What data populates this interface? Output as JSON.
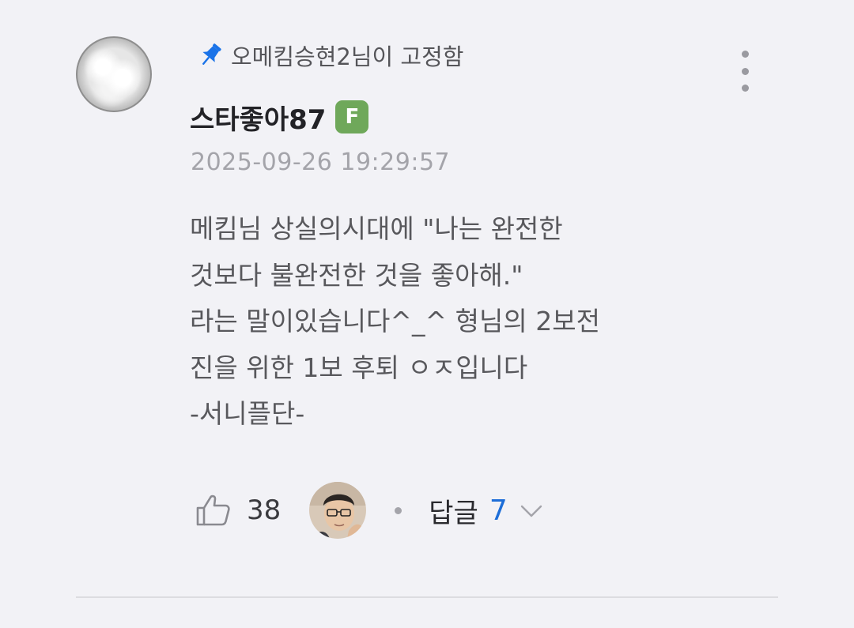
{
  "comment": {
    "pinned_text": "오메킴승현2님이 고정함",
    "author": {
      "name": "스타좋아87",
      "badge": "F"
    },
    "timestamp": "2025-09-26 19:29:57",
    "body_lines": [
      "메킴님 상실의시대에 \"나는 완전한",
      "것보다 불완전한 것을 좋아해.\"",
      "라는 말이있습니다^_^ 형님의 2보전",
      "진을 위한 1보 후퇴 ㅇㅈ입니다",
      "-서니플단-"
    ],
    "likes": "38",
    "reply_label": "답글",
    "reply_count": "7",
    "icons": {
      "pin": "pin-icon",
      "more": "more-vertical-icon",
      "like": "thumbs-up-icon",
      "expand": "chevron-down-icon"
    },
    "colors": {
      "background": "#f2f2f6",
      "pin_accent": "#1a73e8",
      "badge": "#6fa85a",
      "reply_count": "#1d6ed8"
    }
  }
}
